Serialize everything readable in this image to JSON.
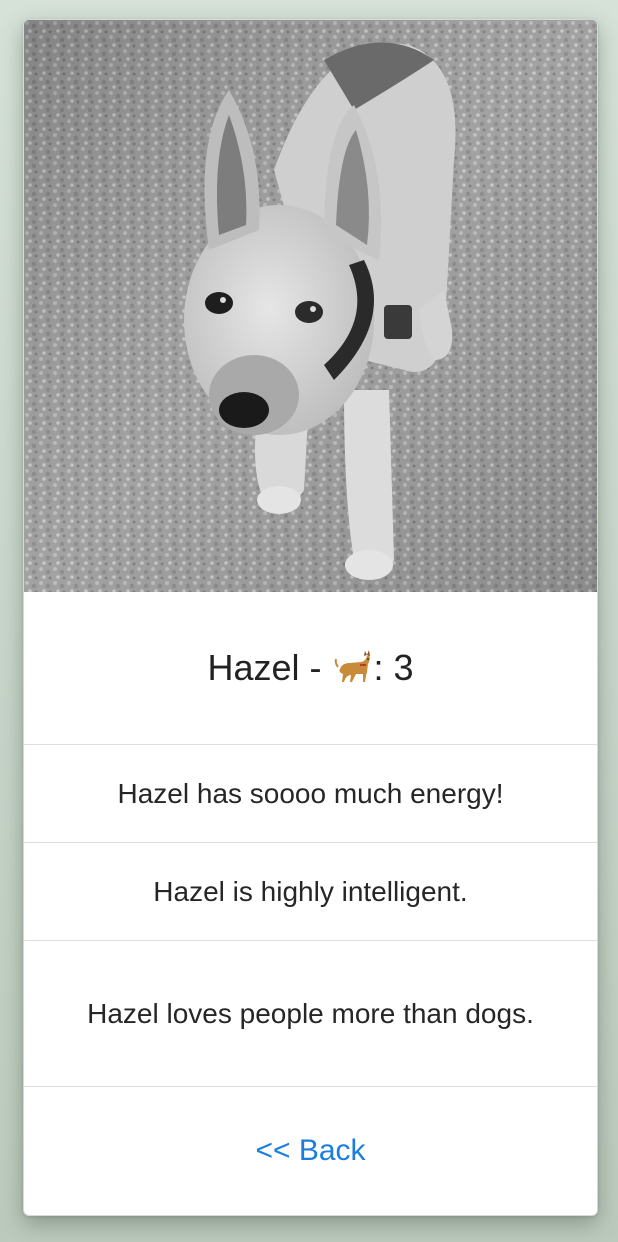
{
  "pet": {
    "name": "Hazel",
    "separator": "-",
    "age_label": ": 3",
    "age_icon": "dog-emoji-icon"
  },
  "traits": [
    {
      "text": "Hazel has soooo much energy!"
    },
    {
      "text": "Hazel is highly intelligent."
    },
    {
      "text": "Hazel loves people more than dogs."
    }
  ],
  "nav": {
    "back_label": "<< Back"
  },
  "colors": {
    "link": "#1a7de0",
    "divider": "#dedede"
  }
}
